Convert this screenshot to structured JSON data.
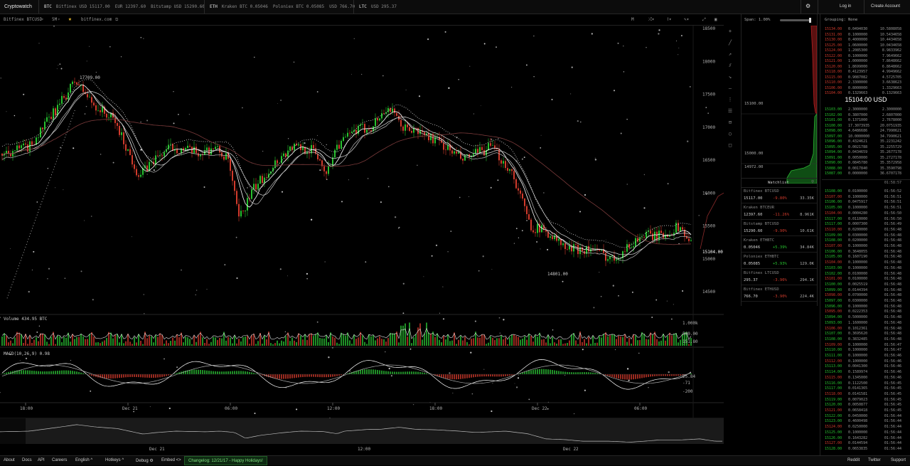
{
  "app": {
    "brand": "Cryptowatch"
  },
  "topbar": {
    "groups": [
      {
        "coin": "BTC",
        "quotes": [
          "Bitfinex USD 15117.00",
          "EUR 12397.60",
          "Bitstamp USD 15290.60"
        ]
      },
      {
        "coin": "ETH",
        "quotes": [
          "Kraken BTC 0.05046",
          "Poloniex BTC 0.05085",
          "USD 766.70"
        ]
      },
      {
        "coin": "LTC",
        "quotes": [
          "USD 295.37"
        ]
      }
    ],
    "settings_icon": "gear-icon",
    "login": "Log in",
    "create_account": "Create Account"
  },
  "chart_toolbar": {
    "market": "Bitfinex BTCUSD",
    "period": "5M",
    "star_icon": "star-icon",
    "site": "bitfinex.com",
    "right_tools": [
      "M",
      "indicators",
      "lines",
      "draw",
      "fullscreen",
      "close"
    ]
  },
  "price_axis": {
    "ticks": [
      "18500",
      "18000",
      "17500",
      "17000",
      "16500",
      "16000",
      "15500",
      "15000",
      "14500"
    ],
    "current": "15104.00"
  },
  "annotations": {
    "high": "17709.00",
    "low": "14801.00"
  },
  "volume": {
    "label": "Volume 434.95 BTC",
    "ticks": [
      "1.000k",
      "500.00",
      "151.80"
    ]
  },
  "macd": {
    "label": "MACD(10,26,9) 0.98",
    "ticks": [
      "25.84",
      "-71",
      "-200"
    ]
  },
  "time_axis": [
    "18:00",
    "Dec 21",
    "06:00",
    "12:00",
    "18:00",
    "Dec 22",
    "06:00"
  ],
  "overview_axis": [
    "Dec 21",
    "12:00",
    "Dec 22"
  ],
  "depth": {
    "span_label": "Span: 1.00%",
    "price_labels": [
      "15100.00",
      "15000.00",
      "14972.00"
    ]
  },
  "watchlist": {
    "title": "Watchlist",
    "items": [
      {
        "name": "Bitfinex BTCUSD",
        "price": "15117.00",
        "change": "-9.80%",
        "vol": "33.35K",
        "up": false
      },
      {
        "name": "Kraken BTCEUR",
        "price": "12397.60",
        "change": "-11.26%",
        "vol": "8.961K",
        "up": false
      },
      {
        "name": "Bitstamp BTCUSD",
        "price": "15290.60",
        "change": "-9.90%",
        "vol": "10.61K",
        "up": false
      },
      {
        "name": "Kraken ETHBTC",
        "price": "0.05046",
        "change": "+5.39%",
        "vol": "34.84K",
        "up": true
      },
      {
        "name": "Poloniex ETHBTC",
        "price": "0.05085",
        "change": "+5.93%",
        "vol": "129.0K",
        "up": true
      },
      {
        "name": "Bitfinex LTCUSD",
        "price": "295.37",
        "change": "-3.96%",
        "vol": "294.1K",
        "up": false
      },
      {
        "name": "Bitfinex ETHUSD",
        "price": "766.70",
        "change": "-3.90%",
        "vol": "224.4K",
        "up": false
      }
    ]
  },
  "orderbook": {
    "grouping": "Grouping: None",
    "mid_price": "15104.00 USD",
    "asks": [
      [
        "15134.00",
        "0.0494030",
        "10.5808058"
      ],
      [
        "15131.00",
        "0.1000000",
        "10.5434658"
      ],
      [
        "15130.00",
        "0.4000000",
        "10.4434658"
      ],
      [
        "15125.00",
        "1.0600000",
        "10.0434658"
      ],
      [
        "15124.00",
        "1.2085300",
        "8.9833962"
      ],
      [
        "15122.00",
        "0.1000000",
        "7.9649662"
      ],
      [
        "15121.00",
        "1.0000000",
        "7.8648662"
      ],
      [
        "15120.00",
        "1.8699000",
        "6.8648662"
      ],
      [
        "15118.00",
        "0.4123957",
        "4.9949662"
      ],
      [
        "15115.00",
        "0.9087082",
        "4.5725705"
      ],
      [
        "15110.00",
        "2.3300000",
        "3.6638623"
      ],
      [
        "15106.00",
        "0.8000000",
        "1.3329663"
      ],
      [
        "15104.00",
        "0.1329663",
        "0.1329663"
      ]
    ],
    "bids": [
      [
        "15103.00",
        "2.3000000",
        "2.3000000"
      ],
      [
        "15102.00",
        "0.3807000",
        "2.6807000"
      ],
      [
        "15101.00",
        "0.1371000",
        "2.7678000"
      ],
      [
        "15100.00",
        "17.3073935",
        "20.0751935"
      ],
      [
        "15098.00",
        "4.6486686",
        "24.7990621"
      ],
      [
        "15097.00",
        "10.0000000",
        "34.7990621"
      ],
      [
        "15096.00",
        "0.4324621",
        "35.2231242"
      ],
      [
        "15095.00",
        "0.0021788",
        "35.2255729"
      ],
      [
        "15094.00",
        "0.0434659",
        "35.2677178"
      ],
      [
        "15091.00",
        "0.0050000",
        "35.2727178"
      ],
      [
        "15090.00",
        "0.0845780",
        "35.3572958"
      ],
      [
        "15088.00",
        "0.0017840",
        "35.3590798"
      ],
      [
        "15087.00",
        "0.0000000",
        "36.6707178"
      ]
    ],
    "trades_header": "01:58:57",
    "trades": [
      [
        "15108.00",
        "0.0100000",
        "01:56:52"
      ],
      [
        "15107.00",
        "0.1000000",
        "01:56:51"
      ],
      [
        "15106.00",
        "0.0475917",
        "01:56:51"
      ],
      [
        "15105.00",
        "0.1000000",
        "01:56:51"
      ],
      [
        "15104.00",
        "0.0004280",
        "01:56:50"
      ],
      [
        "15117.00",
        "0.0110000",
        "01:56:50"
      ],
      [
        "15117.00",
        "0.0007300",
        "01:56:49"
      ],
      [
        "15110.00",
        "0.0200000",
        "01:56:48"
      ],
      [
        "15109.00",
        "0.0300000",
        "01:56:48"
      ],
      [
        "15108.00",
        "0.0200000",
        "01:56:48"
      ],
      [
        "15107.00",
        "0.1000000",
        "01:56:48"
      ],
      [
        "15106.00",
        "0.3648055",
        "01:56:48"
      ],
      [
        "15105.00",
        "0.1607190",
        "01:56:48"
      ],
      [
        "15104.00",
        "0.1000000",
        "01:56:48"
      ],
      [
        "15103.00",
        "0.1000000",
        "01:56:48"
      ],
      [
        "15102.00",
        "0.0100000",
        "01:56:48"
      ],
      [
        "15101.00",
        "0.0100000",
        "01:56:48"
      ],
      [
        "15100.00",
        "0.0025519",
        "01:56:48"
      ],
      [
        "15099.00",
        "0.0144394",
        "01:56:48"
      ],
      [
        "15098.00",
        "0.0700000",
        "01:56:48"
      ],
      [
        "15097.00",
        "0.0300000",
        "01:56:48"
      ],
      [
        "15096.00",
        "0.1000000",
        "01:56:48"
      ],
      [
        "15095.00",
        "0.0222353",
        "01:56:48"
      ],
      [
        "15094.00",
        "0.5000000",
        "01:56:48"
      ],
      [
        "15093.00",
        "1.1600000",
        "01:56:48"
      ],
      [
        "15106.00",
        "0.1012361",
        "01:56:48"
      ],
      [
        "15107.00",
        "0.3695620",
        "01:56:48"
      ],
      [
        "15108.00",
        "0.3832485",
        "01:56:48"
      ],
      [
        "15109.00",
        "0.1000000",
        "01:56:47"
      ],
      [
        "15110.00",
        "0.1000000",
        "01:56:47"
      ],
      [
        "15111.00",
        "0.1000000",
        "01:56:46"
      ],
      [
        "15112.00",
        "0.1000000",
        "01:56:46"
      ],
      [
        "15113.00",
        "0.0041300",
        "01:56:46"
      ],
      [
        "15114.00",
        "0.1589974",
        "01:56:46"
      ],
      [
        "15115.00",
        "0.1345000",
        "01:56:46"
      ],
      [
        "15116.00",
        "0.1122500",
        "01:56:45"
      ],
      [
        "15117.00",
        "0.0141365",
        "01:56:45"
      ],
      [
        "15118.00",
        "0.0141581",
        "01:56:45"
      ],
      [
        "15119.00",
        "0.0079023",
        "01:56:45"
      ],
      [
        "15120.00",
        "0.0050877",
        "01:56:45"
      ],
      [
        "15121.00",
        "0.0658418",
        "01:56:45"
      ],
      [
        "15122.00",
        "0.0450000",
        "01:56:44"
      ],
      [
        "15123.00",
        "0.4600498",
        "01:56:44"
      ],
      [
        "15124.00",
        "0.0250000",
        "01:56:44"
      ],
      [
        "15125.00",
        "0.1000000",
        "01:56:44"
      ],
      [
        "15126.00",
        "0.1643282",
        "01:56:44"
      ],
      [
        "15127.00",
        "0.0144594",
        "01:56:44"
      ],
      [
        "15128.00",
        "0.0653835",
        "01:56:44"
      ]
    ]
  },
  "footer": {
    "links": [
      "About",
      "Docs",
      "API",
      "Careers",
      "English ^",
      "Hotkeys ^",
      "Debug ⚙",
      "Embed <>"
    ],
    "changelog": "Changelog: 12/21/17 - Happy Holidays!",
    "right_links": [
      "Reddit",
      "Twitter",
      "Support"
    ]
  },
  "colors": {
    "up": "#27c22f",
    "down": "#d23b2c",
    "bg": "#000000",
    "line": "#ffffff"
  }
}
